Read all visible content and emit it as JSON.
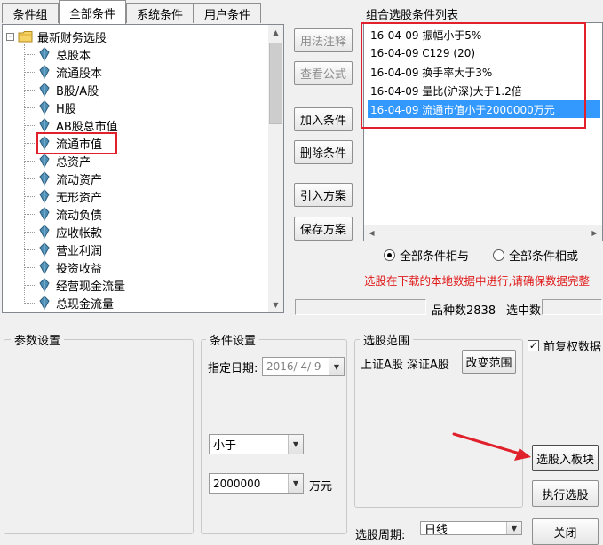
{
  "tabs": [
    {
      "label": "条件组",
      "active": false
    },
    {
      "label": "全部条件",
      "active": true
    },
    {
      "label": "系统条件",
      "active": false
    },
    {
      "label": "用户条件",
      "active": false
    }
  ],
  "tree": {
    "root_label": "最新财务选股",
    "items": [
      "总股本",
      "流通股本",
      "B股/A股",
      "H股",
      "AB股总市值",
      "流通市值",
      "总资产",
      "流动资产",
      "无形资产",
      "流动负债",
      "应收帐款",
      "营业利润",
      "投资收益",
      "经营现金流量",
      "总现金流量"
    ],
    "selected": "流通市值"
  },
  "side_buttons": {
    "usage_note": "用法注释",
    "view_formula": "查看公式",
    "add_condition": "加入条件",
    "delete_condition": "删除条件",
    "import_scheme": "引入方案",
    "save_scheme": "保存方案"
  },
  "combined_list": {
    "title": "组合选股条件列表",
    "items": [
      "16-04-09 振幅小于5%",
      "16-04-09 C129 (20)",
      "16-04-09 换手率大于3%",
      "16-04-09 量比(沪深)大于1.2倍",
      "16-04-09 流通市值小于2000000万元"
    ],
    "selected_index": 4
  },
  "logic": {
    "and_label": "全部条件相与",
    "or_label": "全部条件相或",
    "selected": "and"
  },
  "warning_text": "选股在下载的本地数据中进行,请确保数据完整",
  "counts": {
    "variety_label": "品种数",
    "variety_value": "2838",
    "selected_label": "选中数",
    "selected_value": ""
  },
  "params_group": {
    "title": "参数设置"
  },
  "condition_group": {
    "title": "条件设置",
    "date_label": "指定日期:",
    "date_value": "2016/ 4/ 9",
    "compare_value": "小于",
    "amount_value": "2000000",
    "amount_unit": "万元"
  },
  "range_group": {
    "title": "选股范围",
    "range_text": "上证A股 深证A股",
    "change_range": "改变范围",
    "period_label": "选股周期:",
    "period_value": "日线"
  },
  "pre_rights": {
    "label": "前复权数据",
    "checked": true
  },
  "action_buttons": {
    "add_to_block": "选股入板块",
    "execute": "执行选股",
    "close": "关闭"
  },
  "colors": {
    "highlight_red": "#e0202a",
    "selection_blue": "#3399ff",
    "warning_red": "#e01b1b"
  }
}
